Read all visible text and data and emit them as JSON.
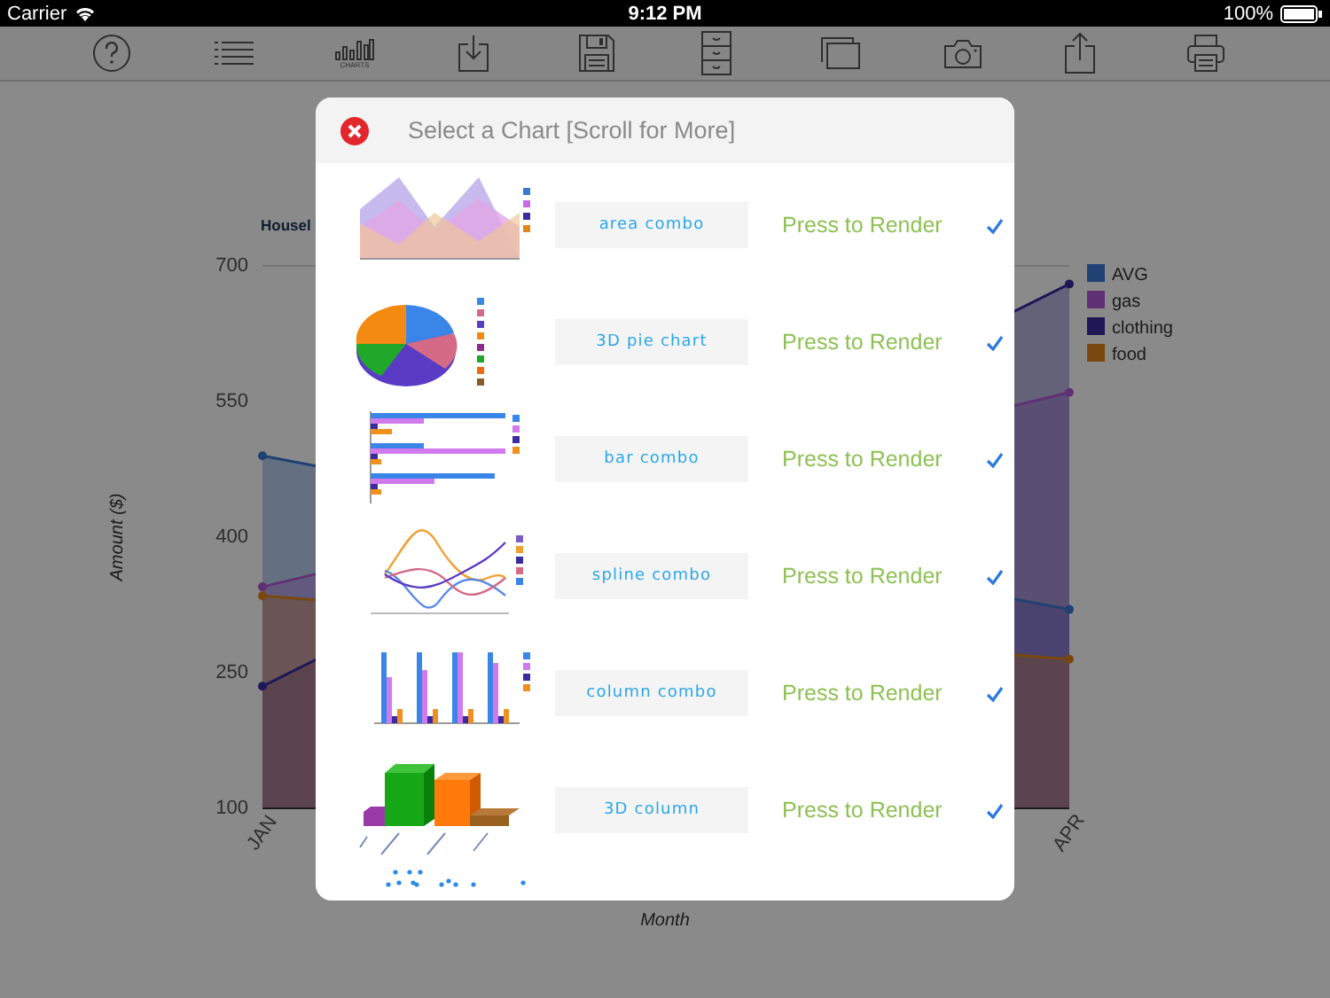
{
  "status_bar": {
    "carrier": "Carrier",
    "time": "9:12 PM",
    "battery": "100%"
  },
  "toolbar": [
    {
      "kind": "help"
    },
    {
      "kind": "list"
    },
    {
      "kind": "charts",
      "label": "CHARTS"
    },
    {
      "kind": "download"
    },
    {
      "kind": "save"
    },
    {
      "kind": "cabinet"
    },
    {
      "kind": "windows"
    },
    {
      "kind": "camera"
    },
    {
      "kind": "share"
    },
    {
      "kind": "print"
    }
  ],
  "chart": {
    "chart_data": {
      "type": "area",
      "legend": "right",
      "stacked": false,
      "title": "Housel",
      "xlabel": "Month",
      "ylabel": "Amount ($)",
      "categories": [
        "JAN",
        "APR"
      ],
      "ylim": [
        100,
        700
      ],
      "yticks": [
        100,
        250,
        400,
        550,
        700
      ],
      "series": [
        {
          "name": "AVG",
          "color": "#3a78d4",
          "values": [
            490,
            320
          ]
        },
        {
          "name": "gas",
          "color": "#b05cd6",
          "values": [
            345,
            560
          ]
        },
        {
          "name": "clothing",
          "color": "#3a2ca0",
          "values": [
            235,
            680
          ]
        },
        {
          "name": "food",
          "color": "#e0861a",
          "values": [
            335,
            265
          ]
        }
      ]
    }
  },
  "modal": {
    "title": "Select a Chart [Scroll for More]",
    "rows": [
      {
        "kind": "area",
        "label": "area combo",
        "action": "Press to Render",
        "checked": true
      },
      {
        "kind": "pie",
        "label": "3D pie chart",
        "action": "Press to Render",
        "checked": true
      },
      {
        "kind": "bar",
        "label": "bar combo",
        "action": "Press to Render",
        "checked": true
      },
      {
        "kind": "spline",
        "label": "spline combo",
        "action": "Press to Render",
        "checked": true
      },
      {
        "kind": "column",
        "label": "column combo",
        "action": "Press to Render",
        "checked": true
      },
      {
        "kind": "column3d",
        "label": "3D column",
        "action": "Press to Render",
        "checked": true
      },
      {
        "kind": "scatter"
      }
    ]
  }
}
